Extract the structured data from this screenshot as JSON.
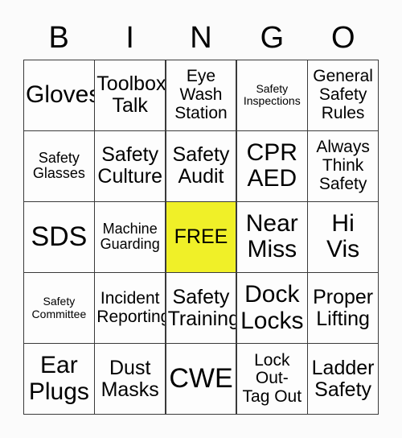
{
  "header": {
    "letters": [
      "B",
      "I",
      "N",
      "G",
      "O"
    ]
  },
  "colors": {
    "free_space_background": "#f0f028",
    "cell_background": "#fdfdfd",
    "page_background": "#fbfbfb",
    "grid_border": "#3a3a3a",
    "text": "#000000"
  },
  "grid": {
    "columns": 5,
    "rows": 5,
    "cells": [
      {
        "text": "Gloves",
        "size": "lg",
        "free": false
      },
      {
        "text": "Toolbox\nTalk",
        "size": "md",
        "free": false
      },
      {
        "text": "Eye\nWash\nStation",
        "size": "sm",
        "free": false
      },
      {
        "text": "Safety\nInspections",
        "size": "xxs",
        "free": false
      },
      {
        "text": "General\nSafety\nRules",
        "size": "sm",
        "free": false
      },
      {
        "text": "Safety\nGlasses",
        "size": "xs",
        "free": false
      },
      {
        "text": "Safety\nCulture",
        "size": "md",
        "free": false
      },
      {
        "text": "Safety\nAudit",
        "size": "md",
        "free": false
      },
      {
        "text": "CPR\nAED",
        "size": "lg",
        "free": false
      },
      {
        "text": "Always\nThink\nSafety",
        "size": "sm",
        "free": false
      },
      {
        "text": "SDS",
        "size": "xl",
        "free": false
      },
      {
        "text": "Machine\nGuarding",
        "size": "xs",
        "free": false
      },
      {
        "text": "FREE",
        "size": "md",
        "free": true
      },
      {
        "text": "Near\nMiss",
        "size": "lg",
        "free": false
      },
      {
        "text": "Hi\nVis",
        "size": "lg",
        "free": false
      },
      {
        "text": "Safety\nCommittee",
        "size": "xxs",
        "free": false
      },
      {
        "text": "Incident\nReporting",
        "size": "sm",
        "free": false
      },
      {
        "text": "Safety\nTraining",
        "size": "md",
        "free": false
      },
      {
        "text": "Dock\nLocks",
        "size": "lg",
        "free": false
      },
      {
        "text": "Proper\nLifting",
        "size": "md",
        "free": false
      },
      {
        "text": "Ear\nPlugs",
        "size": "lg",
        "free": false
      },
      {
        "text": "Dust\nMasks",
        "size": "md",
        "free": false
      },
      {
        "text": "CWE",
        "size": "xl",
        "free": false
      },
      {
        "text": "Lock\nOut-\nTag Out",
        "size": "sm",
        "free": false
      },
      {
        "text": "Ladder\nSafety",
        "size": "md",
        "free": false
      }
    ]
  }
}
